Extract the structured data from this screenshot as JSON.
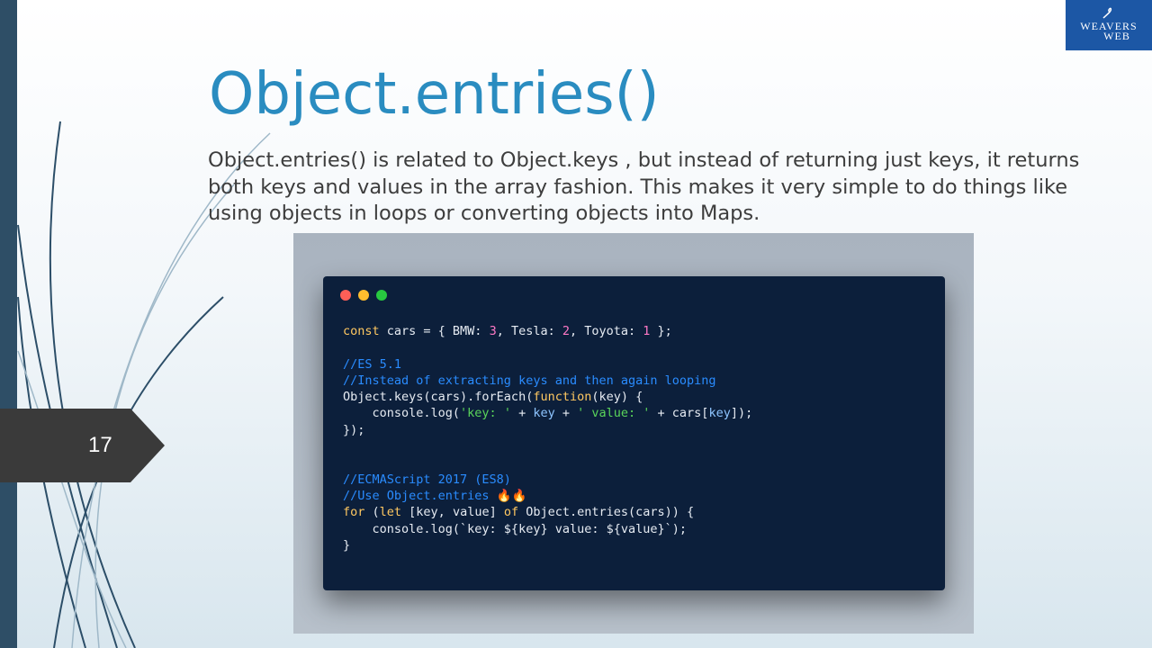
{
  "slide": {
    "title": "Object.entries()",
    "description": "Object.entries() is related to Object.keys , but instead of returning just keys, it returns both keys and values in the array fashion. This makes it very simple to do things like using objects in loops or converting objects into Maps.",
    "page_number": "17"
  },
  "logo": {
    "line1": "WEAVERS",
    "line2": "WEB"
  },
  "code": {
    "l1_a": "const",
    "l1_b": " cars = { BMW: ",
    "l1_c": "3",
    "l1_d": ", Tesla: ",
    "l1_e": "2",
    "l1_f": ", Toyota: ",
    "l1_g": "1",
    "l1_h": " };",
    "c1": "//ES 5.1",
    "c2": "//Instead of extracting keys and then again looping",
    "l2_a": "Object.keys(cars).forEach(",
    "l2_b": "function",
    "l2_c": "(key) {",
    "l3_a": "    console.log(",
    "l3_b": "'key: '",
    "l3_c": " + ",
    "l3_d": "key",
    "l3_e": " + ",
    "l3_f": "' value: '",
    "l3_g": " + cars[",
    "l3_h": "key",
    "l3_i": "]);",
    "l4": "});",
    "c3": "//ECMAScript 2017 (ES8)",
    "c4": "//Use Object.entries 🔥🔥",
    "l5_a": "for",
    "l5_b": " (",
    "l5_c": "let",
    "l5_d": " [key, value] ",
    "l5_e": "of",
    "l5_f": " Object.entries(cars)) {",
    "l6": "    console.log(`key: ${key} value: ${value}`);",
    "l7": "}"
  },
  "colors": {
    "title": "#2a8cc0",
    "code_bg": "#0c1f3b",
    "logo_bg": "#1c57a5"
  }
}
